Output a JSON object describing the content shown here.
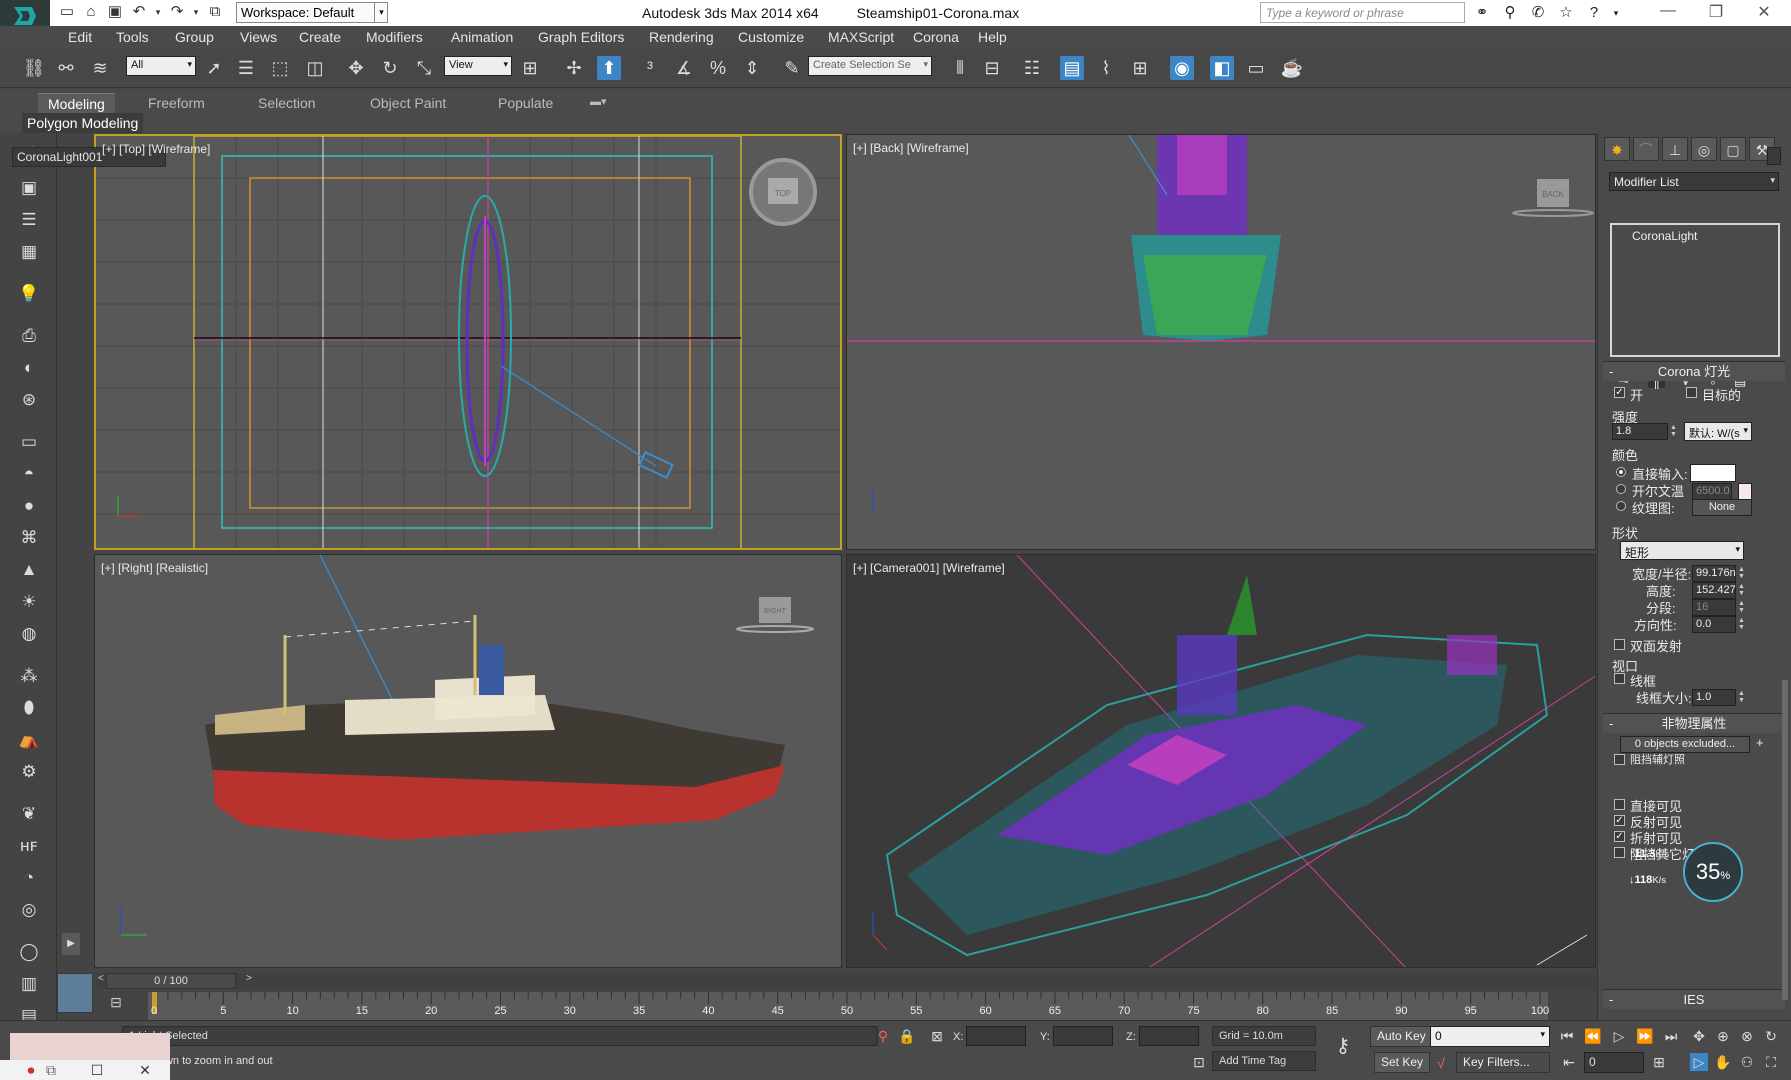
{
  "titlebar": {
    "workspace": "Workspace: Default",
    "app_title": "Autodesk 3ds Max  2014 x64",
    "file_title": "Steamship01-Corona.max",
    "search_placeholder": "Type a keyword or phrase"
  },
  "menus": [
    "Edit",
    "Tools",
    "Group",
    "Views",
    "Create",
    "Modifiers",
    "Animation",
    "Graph Editors",
    "Rendering",
    "Customize",
    "MAXScript",
    "Corona",
    "Help"
  ],
  "toolbar": {
    "selection_filter": "All",
    "reference_coord": "View",
    "named_selection": "Create Selection Se"
  },
  "ribbon": {
    "tabs": [
      "Modeling",
      "Freeform",
      "Selection",
      "Object Paint",
      "Populate"
    ],
    "active_tab": "Modeling",
    "subpanel": "Polygon Modeling"
  },
  "viewports": {
    "top": "[+] [Top] [Wireframe]",
    "back": "[+] [Back] [Wireframe]",
    "right": "[+] [Right] [Realistic]",
    "camera": "[+] [Camera001] [Wireframe]",
    "cube_top": "TOP",
    "cube_back": "BACK",
    "cube_right": "RIGHT"
  },
  "command_panel": {
    "object_name": "CoronaLight001",
    "modifier_list": "Modifier List",
    "stack_item": "CoronaLight",
    "rollout_light": "Corona 灯光",
    "on_label": "开",
    "on_checked": true,
    "target_label": "目标的",
    "target_checked": false,
    "intensity_group": "强度",
    "intensity_value": "1.8",
    "intensity_unit": "默认: W/(s",
    "color_group": "颜色",
    "direct_input": "直接输入:",
    "kelvin": "开尔文温",
    "kelvin_value": "6500.0",
    "texmap": "纹理图:",
    "texmap_value": "None",
    "shape_group": "形状",
    "shape_value": "矩形",
    "width_label": "宽度/半径:",
    "width_value": "99.176n",
    "height_label": "高度:",
    "height_value": "152.427",
    "segments_label": "分段:",
    "segments_value": "16",
    "directionality_label": "方向性:",
    "directionality_value": "0.0",
    "two_sided": "双面发射",
    "viewport_group": "视口",
    "wireframe": "线框",
    "wire_size_label": "线框大小:",
    "wire_size_value": "1.0",
    "rollout_nonphys": "非物理属性",
    "excluded": "0 objects excluded...",
    "occlude_partial": "阻挡辅灯照",
    "visible_direct": "直接可见",
    "visible_reflect": "反射可见",
    "visible_refract": "折射可见",
    "occlude_other": "阻挡其它灯光",
    "rollout_ies": "IES"
  },
  "cpu_overlay": {
    "percent": "35",
    "percent_unit": "%",
    "upload": "11.3",
    "upload_unit": "K/s",
    "download": "118",
    "download_unit": "K/s"
  },
  "timeline": {
    "frame_readout": "0 / 100",
    "ticks": [
      "0",
      "5",
      "10",
      "15",
      "20",
      "25",
      "30",
      "35",
      "40",
      "45",
      "50",
      "55",
      "60",
      "65",
      "70",
      "75",
      "80",
      "85",
      "90",
      "95",
      "100"
    ]
  },
  "status": {
    "selection": "1 Light Selected",
    "prompt": "Click or drag up-and-down to zoom in and out",
    "x_label": "X:",
    "y_label": "Y:",
    "z_label": "Z:",
    "grid": "Grid = 10.0m",
    "add_time_tag": "Add Time Tag",
    "auto_key": "Auto Key",
    "set_key": "Set Key",
    "key_filters": "Key Filters...",
    "selected_dropdown": "0",
    "frame_field": "0"
  }
}
